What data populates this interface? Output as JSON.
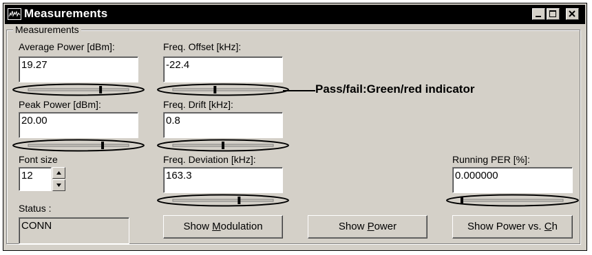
{
  "window": {
    "title": "Measurements"
  },
  "group": {
    "label": "Measurements"
  },
  "fields": {
    "average_power": {
      "label": "Average Power [dBm]:",
      "value": "19.27",
      "indicator": 0.72
    },
    "freq_offset": {
      "label": "Freq. Offset [kHz]:",
      "value": "-22.4",
      "indicator": 0.42
    },
    "peak_power": {
      "label": "Peak Power [dBm]:",
      "value": "20.00",
      "indicator": 0.74
    },
    "freq_drift": {
      "label": "Freq. Drift [kHz]:",
      "value": "0.8",
      "indicator": 0.5
    },
    "font_size": {
      "label": "Font size",
      "value": "12"
    },
    "freq_deviation": {
      "label": "Freq. Deviation [kHz]:",
      "value": "163.3",
      "indicator": 0.66
    },
    "running_per": {
      "label": "Running PER [%]:",
      "value": "0.000000",
      "indicator": 0.0
    },
    "status": {
      "label": "Status :",
      "value": "CONN"
    }
  },
  "buttons": {
    "show_modulation": {
      "prefix": "Show ",
      "mnemonic": "M",
      "suffix": "odulation"
    },
    "show_power": {
      "prefix": "Show ",
      "mnemonic": "P",
      "suffix": "ower"
    },
    "show_power_vs_ch": {
      "prefix": "Show Power vs. ",
      "mnemonic": "C",
      "suffix": "h"
    }
  },
  "callout": {
    "text": "Pass/fail:Green/red indicator"
  },
  "icons": {
    "app": "spectrum-app-icon",
    "minimize": "minimize-icon",
    "maximize": "maximize-icon",
    "close": "close-icon",
    "spin_up": "triangle-up-icon",
    "spin_down": "triangle-down-icon"
  }
}
